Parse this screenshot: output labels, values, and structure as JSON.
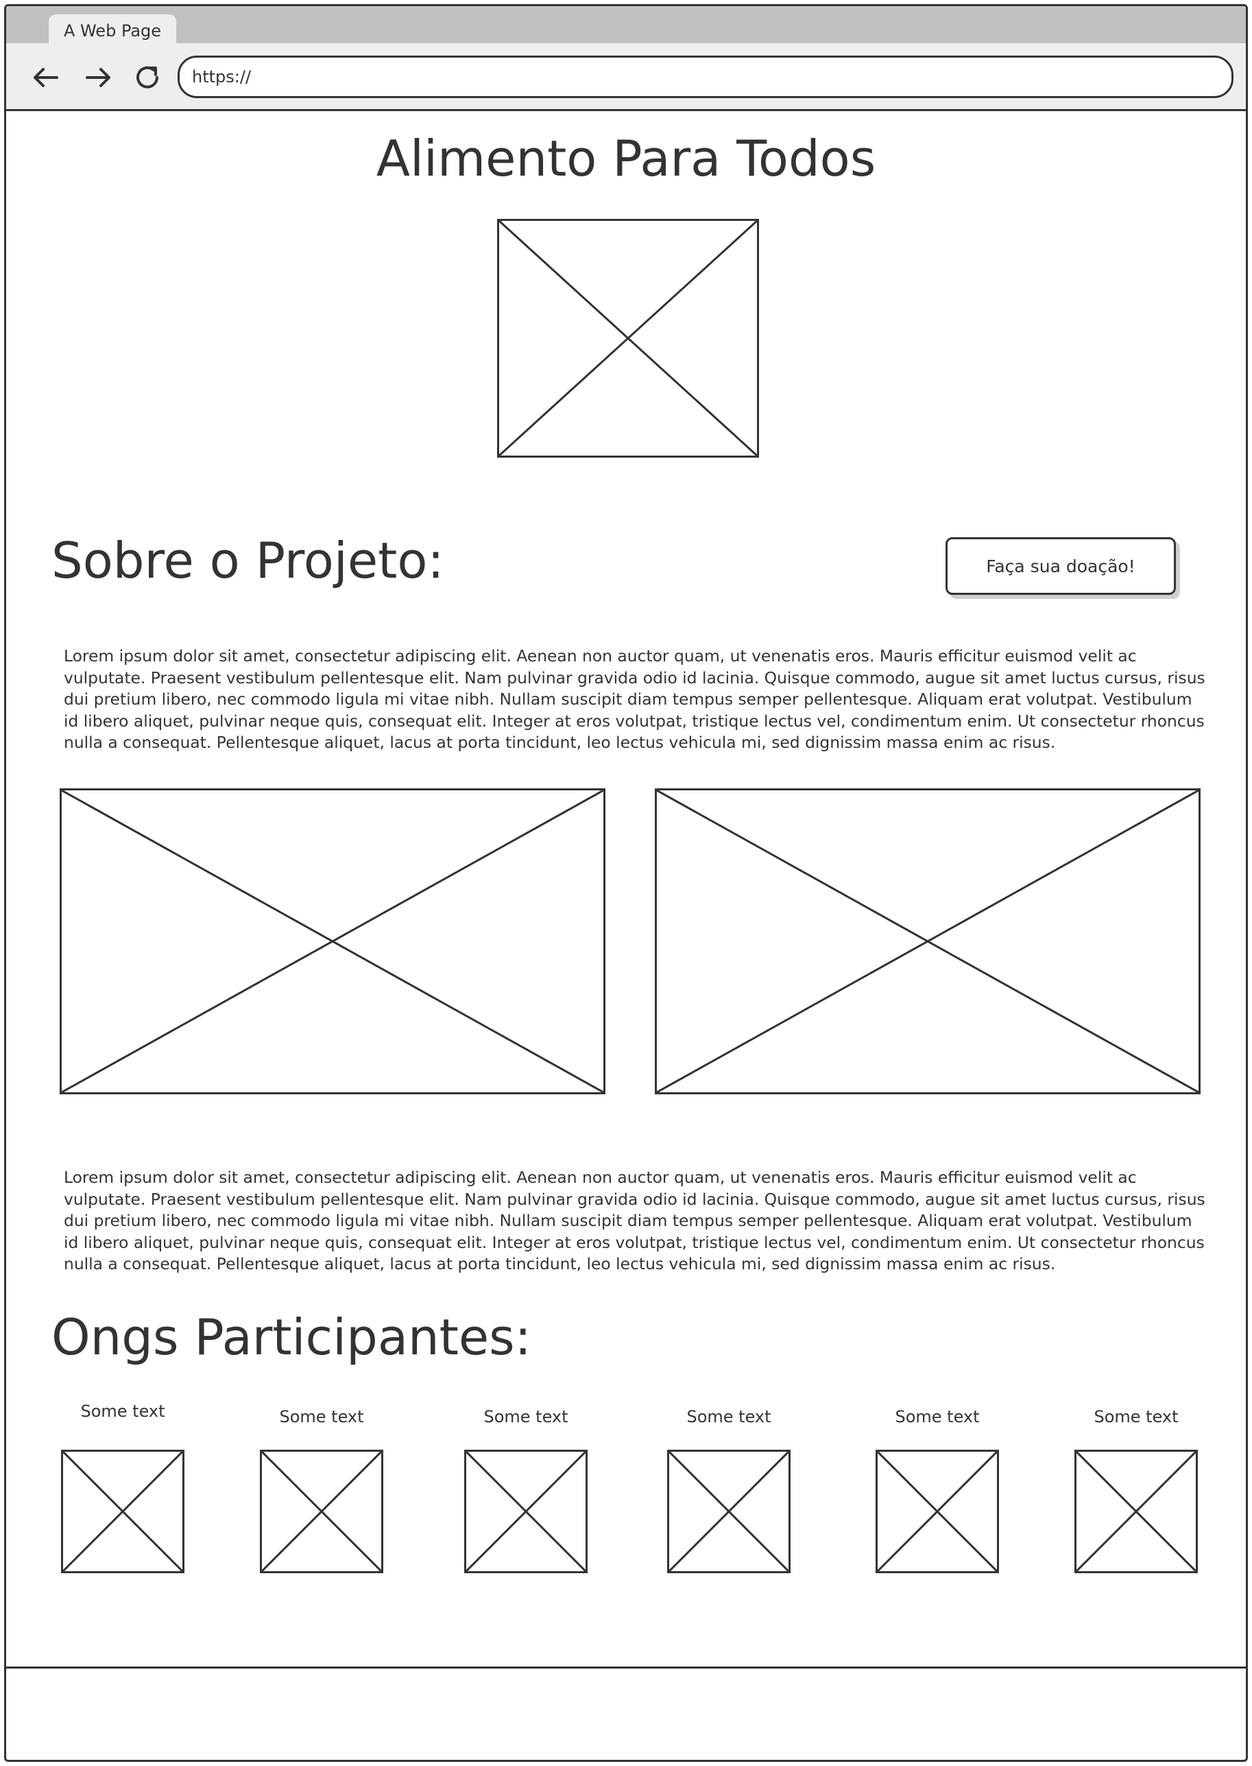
{
  "browser": {
    "tab_title": "A Web Page",
    "url": "https://",
    "icons": [
      "back-arrow-icon",
      "forward-arrow-icon",
      "reload-icon"
    ]
  },
  "page": {
    "title": "Alimento Para Todos",
    "about_heading": "Sobre o Projeto:",
    "donate_button": "Faça sua doação!",
    "paragraph_1": "Lorem ipsum dolor sit amet, consectetur adipiscing elit. Aenean non auctor quam, ut venenatis eros. Mauris efficitur euismod velit ac vulputate. Praesent vestibulum pellentesque elit. Nam pulvinar gravida odio id lacinia. Quisque commodo, augue sit amet luctus cursus, risus dui pretium libero, nec commodo ligula mi vitae nibh. Nullam suscipit diam tempus semper pellentesque. Aliquam erat volutpat. Vestibulum id libero aliquet, pulvinar neque quis, consequat elit. Integer at eros volutpat, tristique lectus vel, condimentum enim. Ut consectetur rhoncus nulla a consequat. Pellentesque aliquet, lacus at porta tincidunt, leo lectus vehicula mi, sed dignissim massa enim ac risus.",
    "paragraph_2": "Lorem ipsum dolor sit amet, consectetur adipiscing elit. Aenean non auctor quam, ut venenatis eros. Mauris efficitur euismod velit ac vulputate. Praesent vestibulum pellentesque elit. Nam pulvinar gravida odio id lacinia. Quisque commodo, augue sit amet luctus cursus, risus dui pretium libero, nec commodo ligula mi vitae nibh. Nullam suscipit diam tempus semper pellentesque. Aliquam erat volutpat. Vestibulum id libero aliquet, pulvinar neque quis, consequat elit. Integer at eros volutpat, tristique lectus vel, condimentum enim. Ut consectetur rhoncus nulla a consequat. Pellentesque aliquet, lacus at porta tincidunt, leo lectus vehicula mi, sed dignissim massa enim ac risus.",
    "ongs_heading": "Ongs Participantes:",
    "ongs": [
      {
        "label": "Some text"
      },
      {
        "label": "Some text"
      },
      {
        "label": "Some text"
      },
      {
        "label": "Some text"
      },
      {
        "label": "Some text"
      },
      {
        "label": "Some text"
      }
    ]
  },
  "colors": {
    "stroke": "#333333",
    "chrome": "#eeeeee",
    "tabstrip": "#c0c0c0"
  }
}
